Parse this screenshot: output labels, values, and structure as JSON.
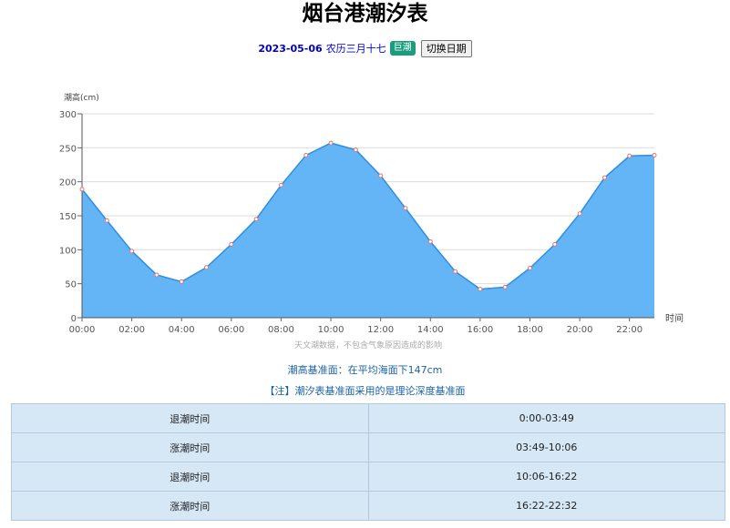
{
  "header": {
    "title": "烟台港潮汐表",
    "date": "2023-05-06",
    "lunar": "农历三月十七",
    "badge": "巨潮",
    "switch_label": "切换日期"
  },
  "chart_data": {
    "type": "area",
    "ylabel": "潮高(cm)",
    "xlabel": "时间",
    "ylim": [
      0,
      300
    ],
    "yticks": [
      0,
      50,
      100,
      150,
      200,
      250,
      300
    ],
    "xticks": [
      "00:00",
      "02:00",
      "04:00",
      "06:00",
      "08:00",
      "10:00",
      "12:00",
      "14:00",
      "16:00",
      "18:00",
      "20:00",
      "22:00"
    ],
    "x": [
      "00:00",
      "01:00",
      "02:00",
      "03:00",
      "04:00",
      "05:00",
      "06:00",
      "07:00",
      "08:00",
      "09:00",
      "10:00",
      "11:00",
      "12:00",
      "13:00",
      "14:00",
      "15:00",
      "16:00",
      "17:00",
      "18:00",
      "19:00",
      "20:00",
      "21:00",
      "22:00",
      "23:00"
    ],
    "values": [
      189,
      143,
      98,
      63,
      53,
      74,
      108,
      145,
      195,
      239,
      257,
      247,
      209,
      161,
      112,
      68,
      42,
      45,
      73,
      108,
      153,
      206,
      238,
      239
    ],
    "footnote": "天文潮数据，不包含气象原因造成的影响",
    "grid": true,
    "colors": {
      "fill": "#64b5f6",
      "line": "#2f8ee0",
      "point": "#e57373"
    }
  },
  "notes": {
    "datum": "潮高基准面：在平均海面下147cm",
    "remark": "【注】潮汐表基准面采用的是理论深度基准面"
  },
  "table": {
    "rows": [
      {
        "label": "退潮时间",
        "value": "0:00-03:49"
      },
      {
        "label": "涨潮时间",
        "value": "03:49-10:06"
      },
      {
        "label": "退潮时间",
        "value": "10:06-16:22"
      },
      {
        "label": "涨潮时间",
        "value": "16:22-22:32"
      }
    ]
  }
}
